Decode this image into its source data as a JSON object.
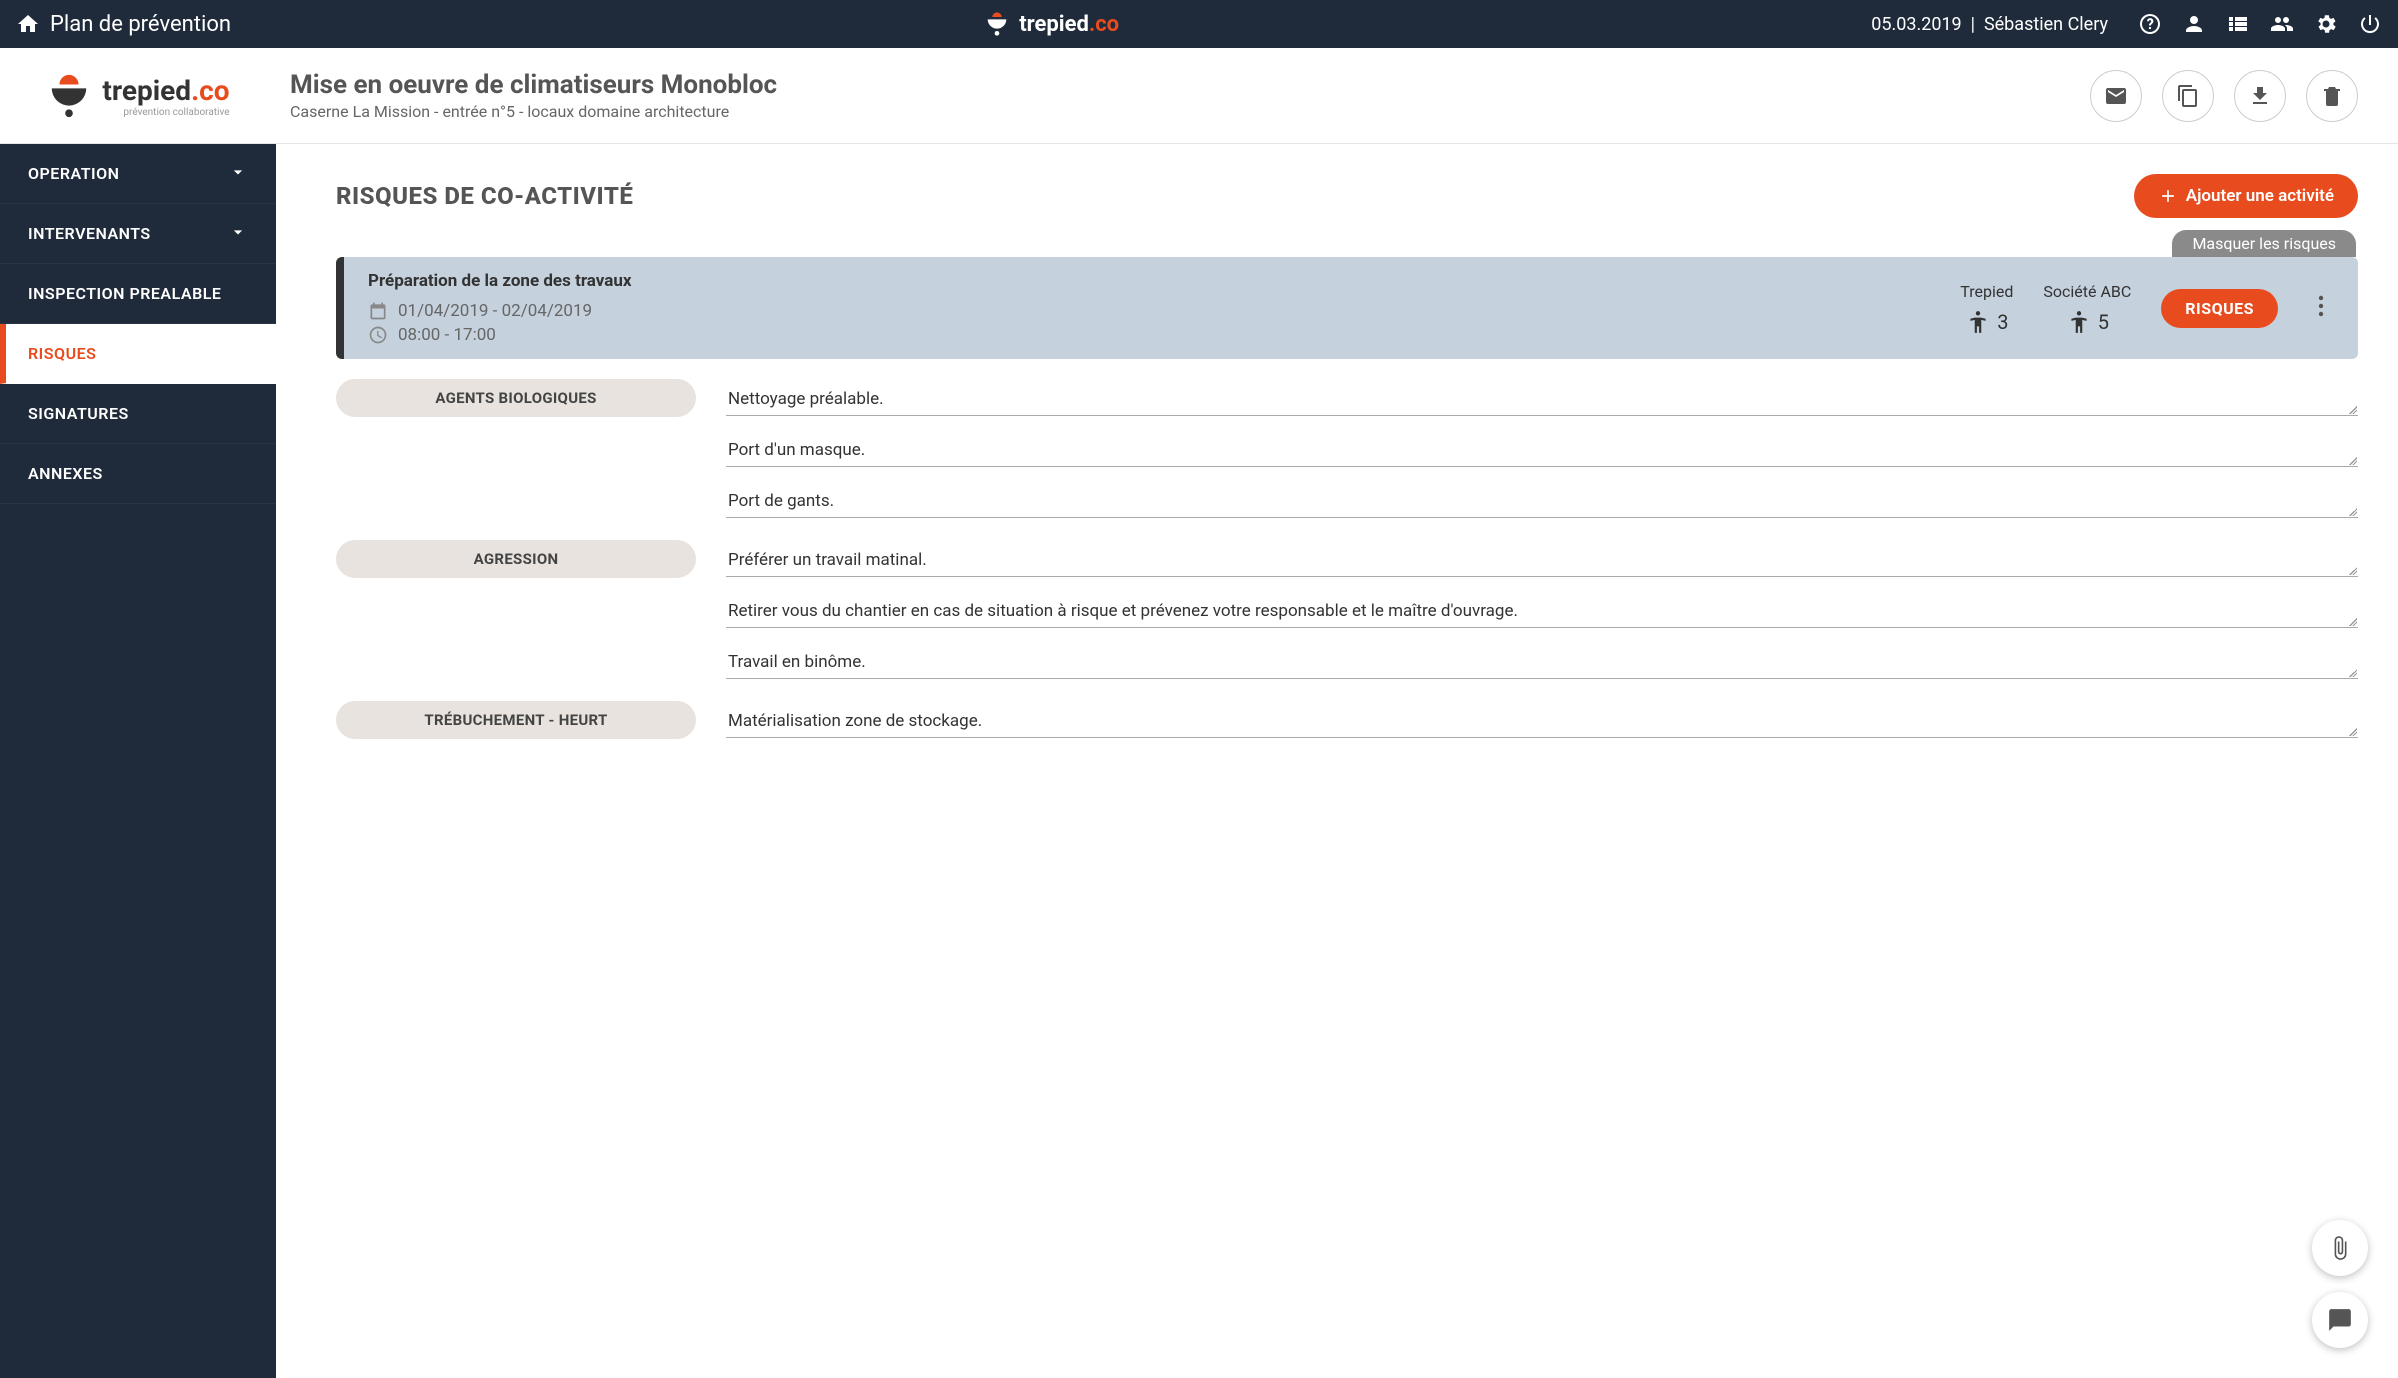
{
  "topbar": {
    "title": "Plan de prévention",
    "brand_a": "trepied",
    "brand_b": ".co",
    "date": "05.03.2019",
    "user": "Sébastien Clery"
  },
  "header": {
    "logo_a": "trepied",
    "logo_b": ".co",
    "logo_tag": "prévention collaborative",
    "title": "Mise en oeuvre de climatiseurs Monobloc",
    "subtitle": "Caserne La Mission - entrée n°5 - locaux domaine architecture"
  },
  "sidebar": {
    "items": [
      {
        "label": "OPERATION",
        "expandable": true
      },
      {
        "label": "INTERVENANTS",
        "expandable": true
      },
      {
        "label": "INSPECTION PREALABLE",
        "expandable": false
      },
      {
        "label": "RISQUES",
        "expandable": false,
        "active": true
      },
      {
        "label": "SIGNATURES",
        "expandable": false
      },
      {
        "label": "ANNEXES",
        "expandable": false
      }
    ]
  },
  "main": {
    "heading": "RISQUES DE CO-ACTIVITÉ",
    "add_label": "Ajouter une activité",
    "mask_label": "Masquer les risques",
    "activity": {
      "title": "Préparation de la zone des travaux",
      "dates": "01/04/2019 - 02/04/2019",
      "hours": "08:00 - 17:00",
      "party1_name": "Trepied",
      "party1_count": "3",
      "party2_name": "Société ABC",
      "party2_count": "5",
      "risk_chip": "RISQUES"
    },
    "risks": [
      {
        "label": "AGENTS BIOLOGIQUES",
        "measures": [
          "Nettoyage préalable.",
          "Port d'un masque.",
          "Port de gants."
        ]
      },
      {
        "label": "AGRESSION",
        "measures": [
          "Préférer un travail matinal.",
          "Retirer vous du chantier en cas de situation à risque et prévenez votre responsable et le maître d'ouvrage.",
          "Travail en binôme."
        ]
      },
      {
        "label": "TRÉBUCHEMENT - HEURT",
        "measures": [
          "Matérialisation zone de stockage."
        ]
      }
    ]
  }
}
